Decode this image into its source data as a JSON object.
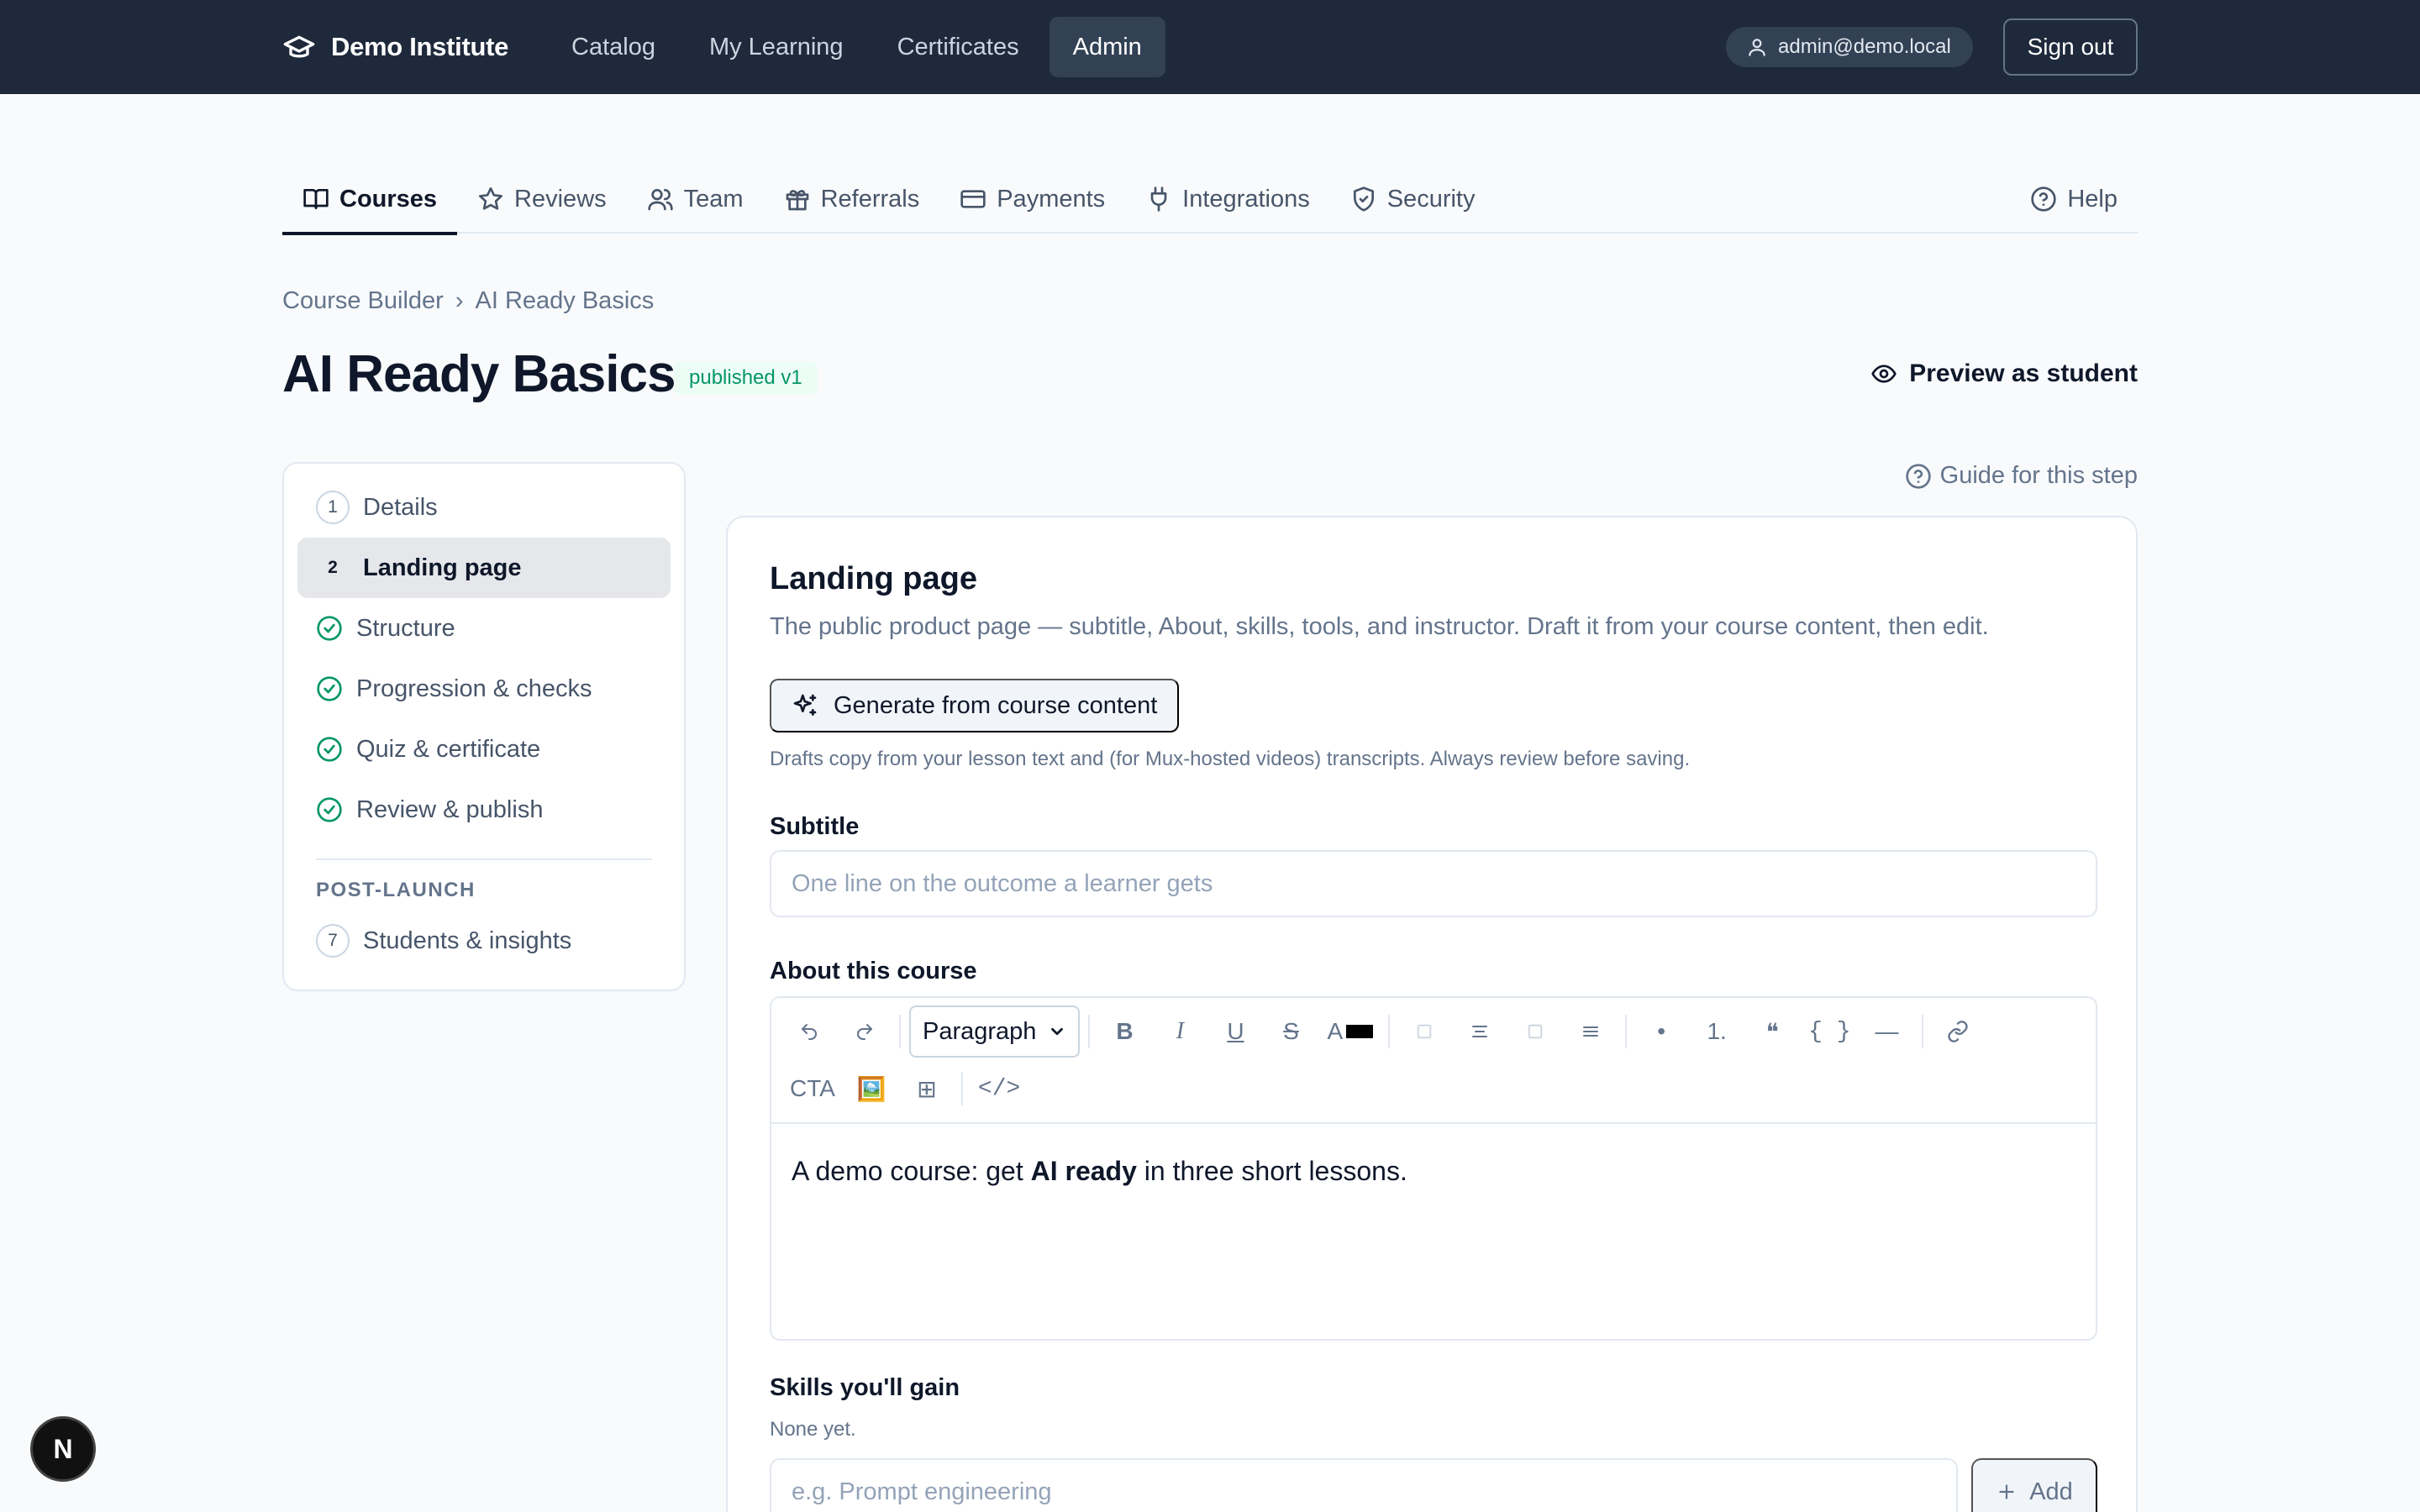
{
  "topbar": {
    "brand": "Demo Institute",
    "nav": [
      "Catalog",
      "My Learning",
      "Certificates",
      "Admin"
    ],
    "active_nav": "Admin",
    "user_email": "admin@demo.local",
    "sign_out": "Sign out"
  },
  "tabs": {
    "items": [
      "Courses",
      "Reviews",
      "Team",
      "Referrals",
      "Payments",
      "Integrations",
      "Security"
    ],
    "active": "Courses",
    "help": "Help"
  },
  "breadcrumb": {
    "parent": "Course Builder",
    "separator": "›",
    "current": "AI Ready Basics"
  },
  "header": {
    "title": "AI Ready Basics",
    "status": "published v1",
    "preview": "Preview as student"
  },
  "steps": {
    "items": [
      {
        "num": "1",
        "label": "Details",
        "state": "pending"
      },
      {
        "num": "2",
        "label": "Landing page",
        "state": "active"
      },
      {
        "num": "3",
        "label": "Structure",
        "state": "done"
      },
      {
        "num": "4",
        "label": "Progression & checks",
        "state": "done"
      },
      {
        "num": "5",
        "label": "Quiz & certificate",
        "state": "done"
      },
      {
        "num": "6",
        "label": "Review & publish",
        "state": "done"
      }
    ],
    "section_label": "POST-LAUNCH",
    "post_launch": {
      "num": "7",
      "label": "Students & insights"
    }
  },
  "guide": "Guide for this step",
  "card": {
    "title": "Landing page",
    "description": "The public product page — subtitle, About, skills, tools, and instructor. Draft it from your course content, then edit.",
    "generate_button": "Generate from course content",
    "generate_note": "Drafts copy from your lesson text and (for Mux-hosted videos) transcripts. Always review before saving.",
    "subtitle_label": "Subtitle",
    "subtitle_placeholder": "One line on the outcome a learner gets",
    "about_label": "About this course",
    "editor": {
      "block_type": "Paragraph",
      "text_before": "A demo course: get ",
      "text_bold": "AI ready",
      "text_after": " in three short lessons.",
      "tools": {
        "bold": "B",
        "italic": "I",
        "underline": "U",
        "strike": "S",
        "color": "A",
        "numbered": "1.",
        "code": "{ }",
        "rule": "—",
        "cta": "CTA",
        "image": "🖼️",
        "table": "⊞",
        "html": "</>",
        "bullet": "•",
        "quote": "❝"
      }
    },
    "skills_label": "Skills you'll gain",
    "skills_note": "None yet.",
    "skills_placeholder": "e.g. Prompt engineering",
    "add_button": "Add"
  },
  "dev_badge": "N",
  "colors": {
    "topbar": "#1e293b",
    "success": "#059669",
    "accent": "#0f172a"
  }
}
